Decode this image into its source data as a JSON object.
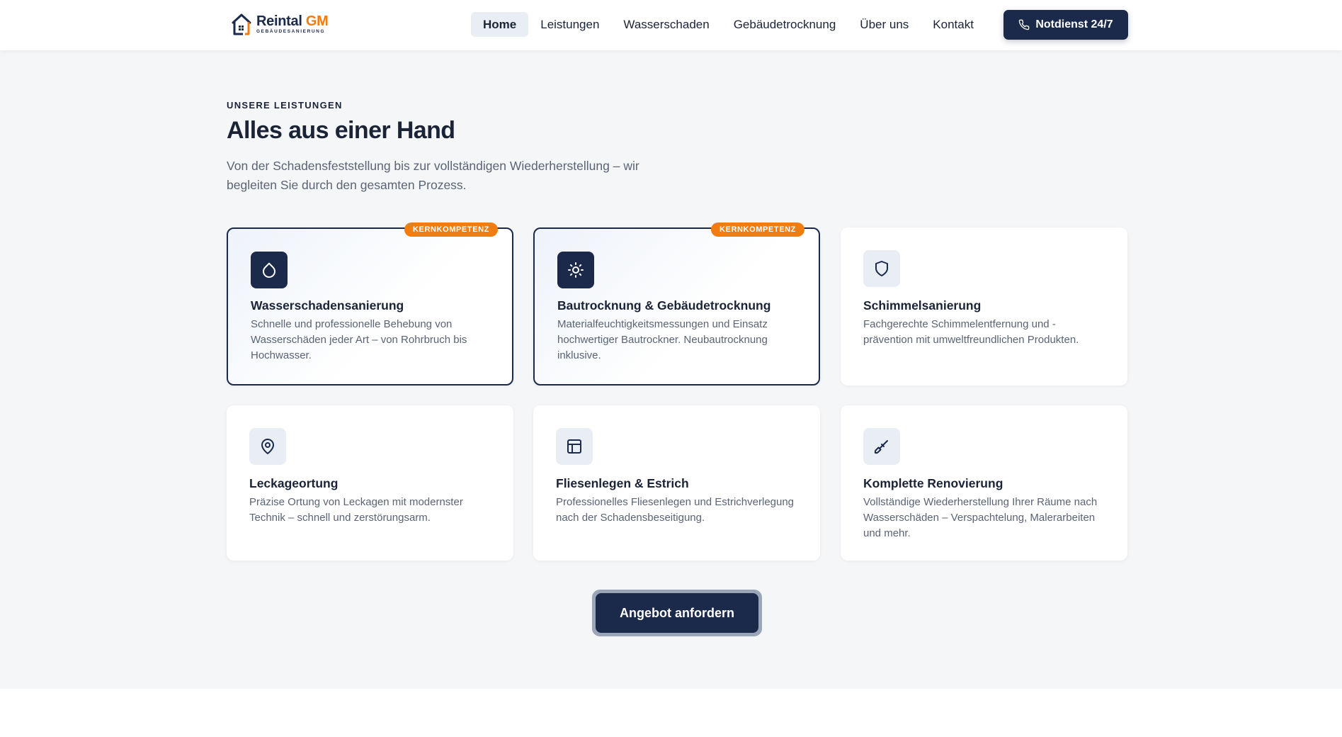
{
  "header": {
    "logo": {
      "name_main": "Reintal",
      "name_accent": "GM",
      "subtitle": "GEBÄUDESANIERUNG"
    },
    "nav": [
      {
        "label": "Home",
        "active": true
      },
      {
        "label": "Leistungen",
        "active": false
      },
      {
        "label": "Wasserschaden",
        "active": false
      },
      {
        "label": "Gebäudetrocknung",
        "active": false
      },
      {
        "label": "Über uns",
        "active": false
      },
      {
        "label": "Kontakt",
        "active": false
      }
    ],
    "emergency_button": {
      "label": "Notdienst 24/7",
      "icon": "phone-icon"
    }
  },
  "section": {
    "eyebrow": "UNSERE LEISTUNGEN",
    "title": "Alles aus einer Hand",
    "lead": "Von der Schadensfeststellung bis zur vollständigen Wiederherstellung – wir begleiten Sie durch den gesamten Prozess.",
    "cards": [
      {
        "title": "Wasserschadensanierung",
        "description": "Schnelle und professionelle Behebung von Wasserschäden jeder Art – von Rohrbruch bis Hochwasser.",
        "badge": "KERNKOMPETENZ",
        "icon": "droplet-icon",
        "featured": true
      },
      {
        "title": "Bautrocknung & Gebäudetrocknung",
        "description": "Materialfeuchtigkeitsmessungen und Einsatz hochwertiger Bautrockner. Neubautrocknung inklusive.",
        "badge": "KERNKOMPETENZ",
        "icon": "sun-icon",
        "featured": true
      },
      {
        "title": "Schimmelsanierung",
        "description": "Fachgerechte Schimmelentfernung und -prävention mit umweltfreundlichen Produkten.",
        "icon": "shield-icon",
        "featured": false
      },
      {
        "title": "Leckageortung",
        "description": "Präzise Ortung von Leckagen mit modernster Technik – schnell und zerstörungsarm.",
        "icon": "map-pin-icon",
        "featured": false
      },
      {
        "title": "Fliesenlegen & Estrich",
        "description": "Professionelles Fliesenlegen und Estrichverlegung nach der Schadensbeseitigung.",
        "icon": "layout-icon",
        "featured": false
      },
      {
        "title": "Komplette Renovierung",
        "description": "Vollständige Wiederherstellung Ihrer Räume nach Wasserschäden – Verspachtelung, Malerarbeiten und mehr.",
        "icon": "brush-icon",
        "featured": false
      }
    ],
    "cta": {
      "label": "Angebot anfordern"
    }
  },
  "colors": {
    "primary": "#1b2a4a",
    "accent": "#ef7d12",
    "background": "#f5f6f8",
    "text": "#1b2436",
    "muted": "#5a6475"
  }
}
